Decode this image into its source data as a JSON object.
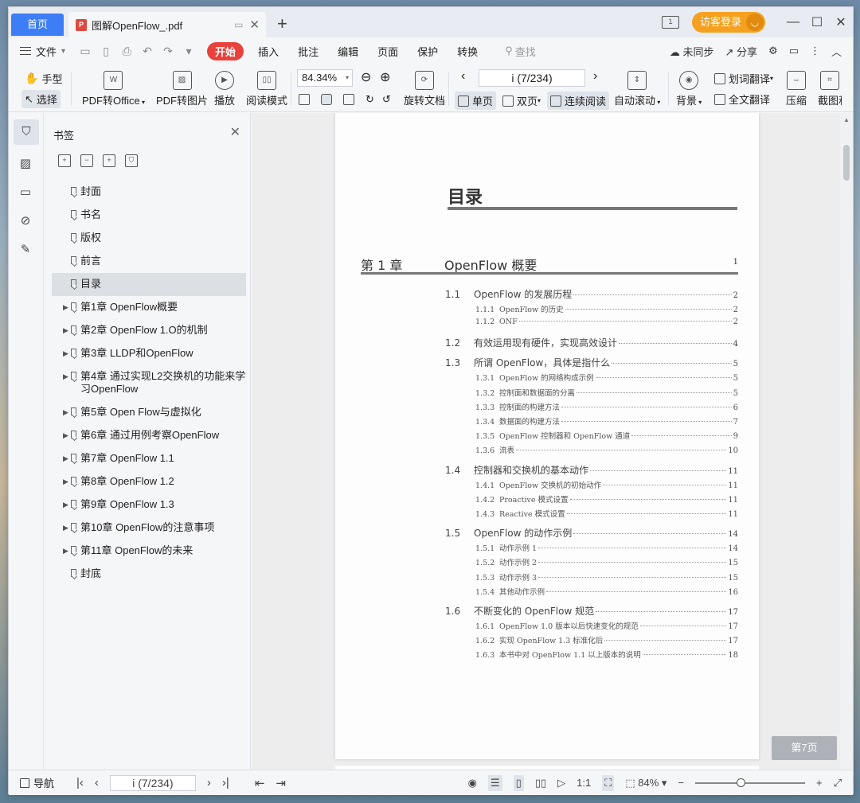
{
  "tabs": {
    "home": "首页",
    "document": "图解OpenFlow_.pdf"
  },
  "titlebar": {
    "page_indicator": "1",
    "login": "访客登录"
  },
  "menu": {
    "file": "文件",
    "items": [
      "开始",
      "插入",
      "批注",
      "编辑",
      "页面",
      "保护",
      "转换"
    ],
    "search": "查找",
    "sync": "未同步",
    "share": "分享"
  },
  "ribbon": {
    "hand": "手型",
    "select": "选择",
    "pdf_to_office": "PDF转Office",
    "pdf_to_image": "PDF转图片",
    "play": "播放",
    "read_mode": "阅读模式",
    "zoom": "84.34%",
    "page": "i (7/234)",
    "rotate": "旋转文档",
    "single": "单页",
    "double": "双页",
    "continuous": "连续阅读",
    "auto_scroll": "自动滚动",
    "background": "背景",
    "word_translate": "划词翻译",
    "full_translate": "全文翻译",
    "compress": "压缩",
    "screenshot": "截图和"
  },
  "bookmarks": {
    "title": "书签",
    "items": [
      {
        "label": "封面",
        "expandable": false
      },
      {
        "label": "书名",
        "expandable": false
      },
      {
        "label": "版权",
        "expandable": false
      },
      {
        "label": "前言",
        "expandable": false
      },
      {
        "label": "目录",
        "expandable": false
      },
      {
        "label": "第1章  OpenFlow概要",
        "expandable": true
      },
      {
        "label": "第2章  OpenFlow 1.O的机制",
        "expandable": true
      },
      {
        "label": "第3章  LLDP和OpenFlow",
        "expandable": true
      },
      {
        "label": "第4章  通过实现L2交换机的功能来学习OpenFlow",
        "expandable": true
      },
      {
        "label": "第5章  Open Flow与虚拟化",
        "expandable": true
      },
      {
        "label": "第6章  通过用例考察OpenFlow",
        "expandable": true
      },
      {
        "label": "第7章  OpenFlow 1.1",
        "expandable": true
      },
      {
        "label": "第8章  OpenFlow 1.2",
        "expandable": true
      },
      {
        "label": "第9章  OpenFlow 1.3",
        "expandable": true
      },
      {
        "label": "第10章  OpenFlow的注意事项",
        "expandable": true
      },
      {
        "label": "第11章  OpenFlow的未来",
        "expandable": true
      },
      {
        "label": "封底",
        "expandable": false
      }
    ]
  },
  "toc": {
    "heading": "目录",
    "chapter_num": "第 1 章",
    "chapter_title": "OpenFlow 概要",
    "chapter_page": "1",
    "rows": [
      {
        "type": "sec",
        "num": "1.1",
        "title": "OpenFlow 的发展历程",
        "page": "2"
      },
      {
        "type": "sub",
        "num": "1.1.1",
        "title": "OpenFlow 的历史",
        "page": "2"
      },
      {
        "type": "sub",
        "num": "1.1.2",
        "title": "ONF",
        "page": "2"
      },
      {
        "type": "sec",
        "num": "1.2",
        "title": "有效运用现有硬件，实现高效设计",
        "page": "4"
      },
      {
        "type": "sec",
        "num": "1.3",
        "title": "所谓 OpenFlow，具体是指什么",
        "page": "5"
      },
      {
        "type": "sub",
        "num": "1.3.1",
        "title": "OpenFlow 的网络构成示例",
        "page": "5"
      },
      {
        "type": "sub",
        "num": "1.3.2",
        "title": "控制面和数据面的分离",
        "page": "5"
      },
      {
        "type": "sub",
        "num": "1.3.3",
        "title": "控制面的构建方法",
        "page": "6"
      },
      {
        "type": "sub",
        "num": "1.3.4",
        "title": "数据面的构建方法",
        "page": "7"
      },
      {
        "type": "sub",
        "num": "1.3.5",
        "title": "OpenFlow 控制器和 OpenFlow 通道",
        "page": "9"
      },
      {
        "type": "sub",
        "num": "1.3.6",
        "title": "流表",
        "page": "10"
      },
      {
        "type": "sec",
        "num": "1.4",
        "title": "控制器和交换机的基本动作",
        "page": "11"
      },
      {
        "type": "sub",
        "num": "1.4.1",
        "title": "OpenFlow 交换机的初始动作",
        "page": "11"
      },
      {
        "type": "sub",
        "num": "1.4.2",
        "title": "Proactive 模式设置",
        "page": "11"
      },
      {
        "type": "sub",
        "num": "1.4.3",
        "title": "Reactive 模式设置",
        "page": "11"
      },
      {
        "type": "sec",
        "num": "1.5",
        "title": "OpenFlow 的动作示例",
        "page": "14"
      },
      {
        "type": "sub",
        "num": "1.5.1",
        "title": "动作示例 1",
        "page": "14"
      },
      {
        "type": "sub",
        "num": "1.5.2",
        "title": "动作示例 2",
        "page": "15"
      },
      {
        "type": "sub",
        "num": "1.5.3",
        "title": "动作示例 3",
        "page": "15"
      },
      {
        "type": "sub",
        "num": "1.5.4",
        "title": "其他动作示例",
        "page": "16"
      },
      {
        "type": "sec",
        "num": "1.6",
        "title": "不断变化的 OpenFlow 规范",
        "page": "17"
      },
      {
        "type": "sub",
        "num": "1.6.1",
        "title": "OpenFlow 1.0 版本以后快速变化的规范",
        "page": "17"
      },
      {
        "type": "sub",
        "num": "1.6.2",
        "title": "实现 OpenFlow 1.3 标准化后",
        "page": "17"
      },
      {
        "type": "sub",
        "num": "1.6.3",
        "title": "本书中对 OpenFlow 1.1 以上版本的说明",
        "page": "18"
      }
    ]
  },
  "float_button": "第7页",
  "status": {
    "nav": "导航",
    "page": "i (7/234)",
    "zoom": "84%"
  },
  "colors": {
    "accent": "#3d7df6",
    "start_tab": "#e9413b",
    "login": "#f5a11f"
  }
}
